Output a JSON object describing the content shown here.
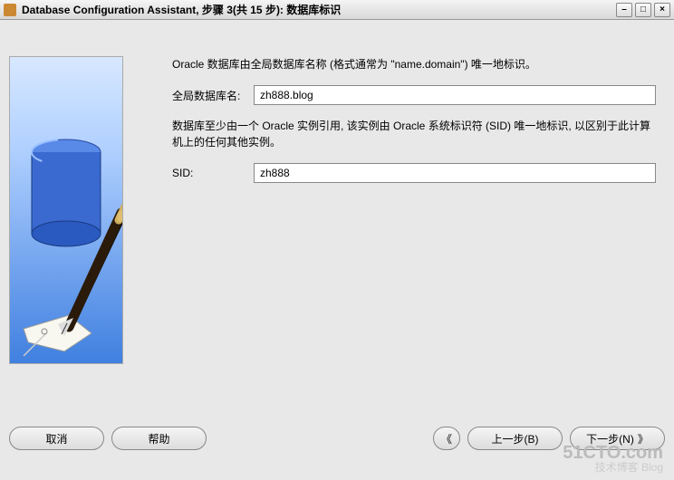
{
  "titlebar": {
    "title": "Database Configuration Assistant, 步骤 3(共 15 步): 数据库标识"
  },
  "content": {
    "description1": "Oracle 数据库由全局数据库名称 (格式通常为 \"name.domain\") 唯一地标识。",
    "globalDbNameLabel": "全局数据库名:",
    "globalDbNameValue": "zh888.blog",
    "description2": "数据库至少由一个 Oracle 实例引用, 该实例由 Oracle 系统标识符 (SID) 唯一地标识, 以区别于此计算机上的任何其他实例。",
    "sidLabel": "SID:",
    "sidValue": "zh888"
  },
  "buttons": {
    "cancel": "取消",
    "help": "帮助",
    "back": "上一步(B)",
    "next": "下一步(N)",
    "backArrow": "《",
    "nextArrow": "》"
  },
  "watermark": {
    "main": "51CTO.com",
    "sub": "技术博客  Blog"
  }
}
